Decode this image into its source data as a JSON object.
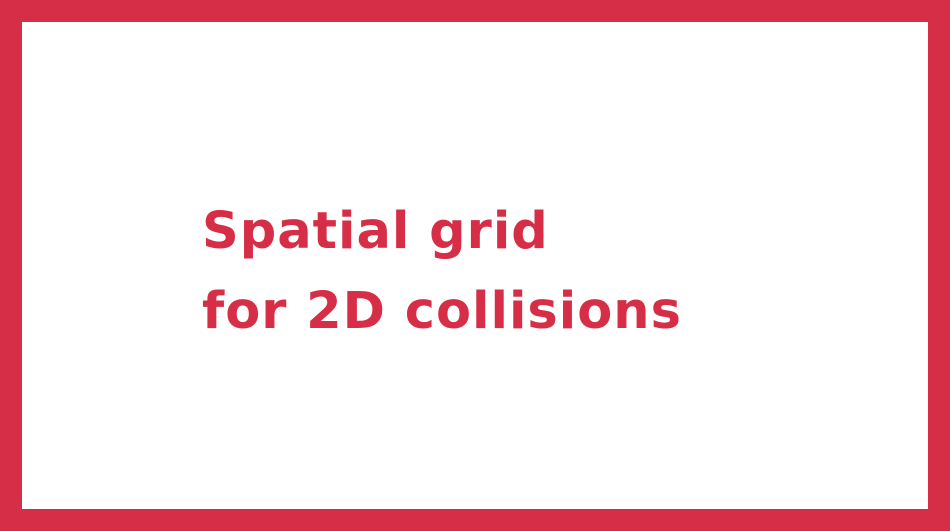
{
  "slide": {
    "title_line_1": "Spatial grid",
    "title_line_2": "for 2D collisions"
  },
  "colors": {
    "accent": "#d72e47",
    "background": "#ffffff"
  }
}
